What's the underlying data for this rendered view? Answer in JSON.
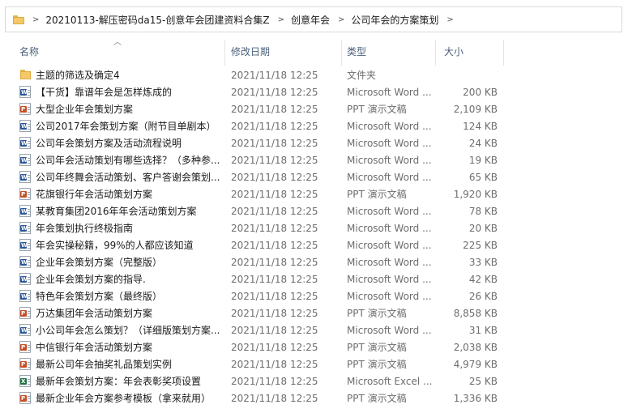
{
  "breadcrumb": {
    "items": [
      "20210113-解压密码da15-创意年会团建资料合集Z",
      "创意年会",
      "公司年会的方案策划"
    ],
    "separator": ">"
  },
  "columns": {
    "name": "名称",
    "date": "修改日期",
    "type": "类型",
    "size": "大小"
  },
  "files": [
    {
      "name": "主题的筛选及确定4",
      "date": "2021/11/18 12:25",
      "type": "文件夹",
      "size": "",
      "icon": "folder-icon"
    },
    {
      "name": "【干货】靠谱年会是怎样炼成的",
      "date": "2021/11/18 12:25",
      "type": "Microsoft Word ...",
      "size": "200 KB",
      "icon": "word-icon"
    },
    {
      "name": "大型企业年会策划方案",
      "date": "2021/11/18 12:25",
      "type": "PPT 演示文稿",
      "size": "2,109 KB",
      "icon": "ppt-icon"
    },
    {
      "name": "公司2017年会策划方案（附节目单剧本）",
      "date": "2021/11/18 12:25",
      "type": "Microsoft Word ...",
      "size": "124 KB",
      "icon": "word-icon"
    },
    {
      "name": "公司年会策划方案及活动流程说明",
      "date": "2021/11/18 12:25",
      "type": "Microsoft Word ...",
      "size": "24 KB",
      "icon": "word-icon"
    },
    {
      "name": "公司年会活动策划有哪些选择？（多种参...",
      "date": "2021/11/18 12:25",
      "type": "Microsoft Word ...",
      "size": "19 KB",
      "icon": "word-icon"
    },
    {
      "name": "公司年终舞会活动策划、客户答谢会策划...",
      "date": "2021/11/18 12:25",
      "type": "Microsoft Word ...",
      "size": "65 KB",
      "icon": "word-icon"
    },
    {
      "name": "花旗银行年会活动策划方案",
      "date": "2021/11/18 12:25",
      "type": "PPT 演示文稿",
      "size": "1,920 KB",
      "icon": "ppt-icon"
    },
    {
      "name": "某教育集团2016年年会活动策划方案",
      "date": "2021/11/18 12:25",
      "type": "Microsoft Word ...",
      "size": "78 KB",
      "icon": "word-icon"
    },
    {
      "name": "年会策划执行终极指南",
      "date": "2021/11/18 12:25",
      "type": "Microsoft Word ...",
      "size": "20 KB",
      "icon": "word-icon"
    },
    {
      "name": "年会实操秘籍，99%的人都应该知道",
      "date": "2021/11/18 12:25",
      "type": "Microsoft Word ...",
      "size": "225 KB",
      "icon": "word-icon"
    },
    {
      "name": "企业年会策划方案（完整版）",
      "date": "2021/11/18 12:25",
      "type": "Microsoft Word ...",
      "size": "33 KB",
      "icon": "word-icon"
    },
    {
      "name": "企业年会策划方案的指导.",
      "date": "2021/11/18 12:25",
      "type": "Microsoft Word ...",
      "size": "42 KB",
      "icon": "word-icon"
    },
    {
      "name": "特色年会策划方案（最终版）",
      "date": "2021/11/18 12:25",
      "type": "Microsoft Word ...",
      "size": "26 KB",
      "icon": "word-icon"
    },
    {
      "name": "万达集团年会活动策划方案",
      "date": "2021/11/18 12:25",
      "type": "PPT 演示文稿",
      "size": "8,858 KB",
      "icon": "ppt-icon"
    },
    {
      "name": "小公司年会怎么策划？（详细版策划方案...",
      "date": "2021/11/18 12:25",
      "type": "Microsoft Word ...",
      "size": "31 KB",
      "icon": "word-icon"
    },
    {
      "name": "中信银行年会活动策划方案",
      "date": "2021/11/18 12:25",
      "type": "PPT 演示文稿",
      "size": "2,038 KB",
      "icon": "ppt-icon"
    },
    {
      "name": "最新公司年会抽奖礼品策划实例",
      "date": "2021/11/18 12:25",
      "type": "PPT 演示文稿",
      "size": "4,979 KB",
      "icon": "ppt-icon"
    },
    {
      "name": "最新年会策划方案：年会表彰奖项设置",
      "date": "2021/11/18 12:25",
      "type": "Microsoft Excel ...",
      "size": "25 KB",
      "icon": "excel-icon"
    },
    {
      "name": "最新企业年会方案参考模板（拿来就用）",
      "date": "2021/11/18 12:25",
      "type": "PPT 演示文稿",
      "size": "1,336 KB",
      "icon": "ppt-icon"
    }
  ]
}
